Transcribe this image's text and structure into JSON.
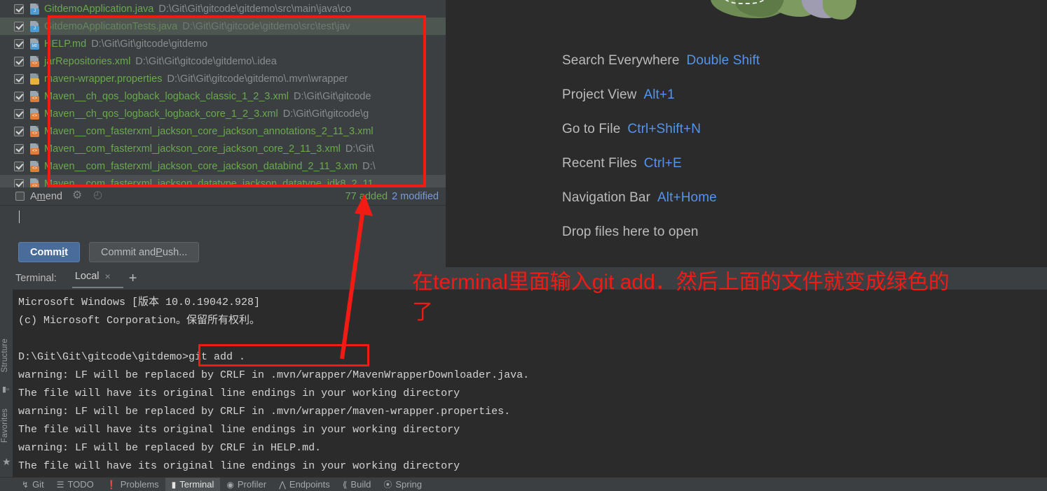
{
  "changes_panel": {
    "files": [
      {
        "name": "GitdemoApplication.java",
        "path": "D:\\Git\\Git\\gitcode\\gitdemo\\src\\main\\java\\co",
        "badge": "J",
        "badge_color": "#4b9bd4",
        "selected": false
      },
      {
        "name": "GitdemoApplicationTests.java",
        "path": "D:\\Git\\Git\\gitcode\\gitdemo\\src\\test\\jav",
        "badge": "J",
        "badge_color": "#4b9bd4",
        "selected": true
      },
      {
        "name": "HELP.md",
        "path": "D:\\Git\\Git\\gitcode\\gitdemo",
        "badge": "MD",
        "badge_color": "#4b9bd4",
        "selected": false
      },
      {
        "name": "jarRepositories.xml",
        "path": "D:\\Git\\Git\\gitcode\\gitdemo\\.idea",
        "badge": "<>",
        "badge_color": "#e07b39",
        "selected": false
      },
      {
        "name": "maven-wrapper.properties",
        "path": "D:\\Git\\Git\\gitcode\\gitdemo\\.mvn\\wrapper",
        "badge": "█",
        "badge_color": "#e8b33a",
        "selected": false
      },
      {
        "name": "Maven__ch_qos_logback_logback_classic_1_2_3.xml",
        "path": "D:\\Git\\Git\\gitcode",
        "badge": "<>",
        "badge_color": "#e07b39",
        "selected": false
      },
      {
        "name": "Maven__ch_qos_logback_logback_core_1_2_3.xml",
        "path": "D:\\Git\\Git\\gitcode\\g",
        "badge": "<>",
        "badge_color": "#e07b39",
        "selected": false
      },
      {
        "name": "Maven__com_fasterxml_jackson_core_jackson_annotations_2_11_3.xml",
        "path": "",
        "badge": "<>",
        "badge_color": "#e07b39",
        "selected": false
      },
      {
        "name": "Maven__com_fasterxml_jackson_core_jackson_core_2_11_3.xml",
        "path": "D:\\Git\\",
        "badge": "<>",
        "badge_color": "#e07b39",
        "selected": false
      },
      {
        "name": "Maven__com_fasterxml_jackson_core_jackson_databind_2_11_3.xm",
        "path": "D:\\",
        "badge": "<>",
        "badge_color": "#e07b39",
        "selected": false
      },
      {
        "name": "Maven__com_fasterxml_jackson_datatype_jackson_datatype_jdk8_2_11",
        "path": "",
        "badge": "<>",
        "badge_color": "#e07b39",
        "selected": false
      }
    ],
    "amend_label_pre": "A",
    "amend_label_accel": "m",
    "amend_label_post": "end",
    "gear_icon": "gear-icon",
    "history_icon": "clock-icon",
    "added_count": "77 added",
    "modified_count": "2 modified",
    "commit_button": {
      "pre": "Comm",
      "accel": "i",
      "post": "t"
    },
    "commit_push_button": {
      "pre": "Commit and ",
      "accel": "P",
      "post": "ush..."
    }
  },
  "editor_hints": {
    "rows": [
      {
        "label": "Search Everywhere",
        "key": "Double Shift"
      },
      {
        "label": "Project View",
        "key": "Alt+1"
      },
      {
        "label": "Go to File",
        "key": "Ctrl+Shift+N"
      },
      {
        "label": "Recent Files",
        "key": "Ctrl+E"
      },
      {
        "label": "Navigation Bar",
        "key": "Alt+Home"
      }
    ],
    "drop_text": "Drop files here to open"
  },
  "terminal": {
    "label": "Terminal:",
    "tab": "Local",
    "close_icon": "×",
    "add_icon": "+",
    "lines": [
      "Microsoft Windows [版本 10.0.19042.928]",
      "(c) Microsoft Corporation。保留所有权利。",
      "",
      "D:\\Git\\Git\\gitcode\\gitdemo>git add .",
      "warning: LF will be replaced by CRLF in .mvn/wrapper/MavenWrapperDownloader.java.",
      "The file will have its original line endings in your working directory",
      "warning: LF will be replaced by CRLF in .mvn/wrapper/maven-wrapper.properties.",
      "The file will have its original line endings in your working directory",
      "warning: LF will be replaced by CRLF in HELP.md.",
      "The file will have its original line endings in your working directory"
    ]
  },
  "left_stripe": {
    "structure_label": "Structure",
    "favorites_label": "Favorites",
    "structure_icon": "structure-icon",
    "favorites_icon": "star-icon"
  },
  "statusbar": {
    "items": [
      {
        "label": "Git",
        "icon": "git-branch-icon",
        "active": false
      },
      {
        "label": "TODO",
        "icon": "list-icon",
        "active": false
      },
      {
        "label": "Problems",
        "icon": "warning-icon",
        "active": false
      },
      {
        "label": "Terminal",
        "icon": "terminal-icon",
        "active": true
      },
      {
        "label": "Profiler",
        "icon": "profiler-icon",
        "active": false
      },
      {
        "label": "Endpoints",
        "icon": "endpoints-icon",
        "active": false
      },
      {
        "label": "Build",
        "icon": "hammer-icon",
        "active": false
      },
      {
        "label": "Spring",
        "icon": "spring-leaf-icon",
        "active": false
      }
    ]
  },
  "annotation": {
    "text_line1": "在terminal里面输入git add．然后上面的文件就变成绿色的",
    "text_line2": "了",
    "color": "#f21b14"
  }
}
